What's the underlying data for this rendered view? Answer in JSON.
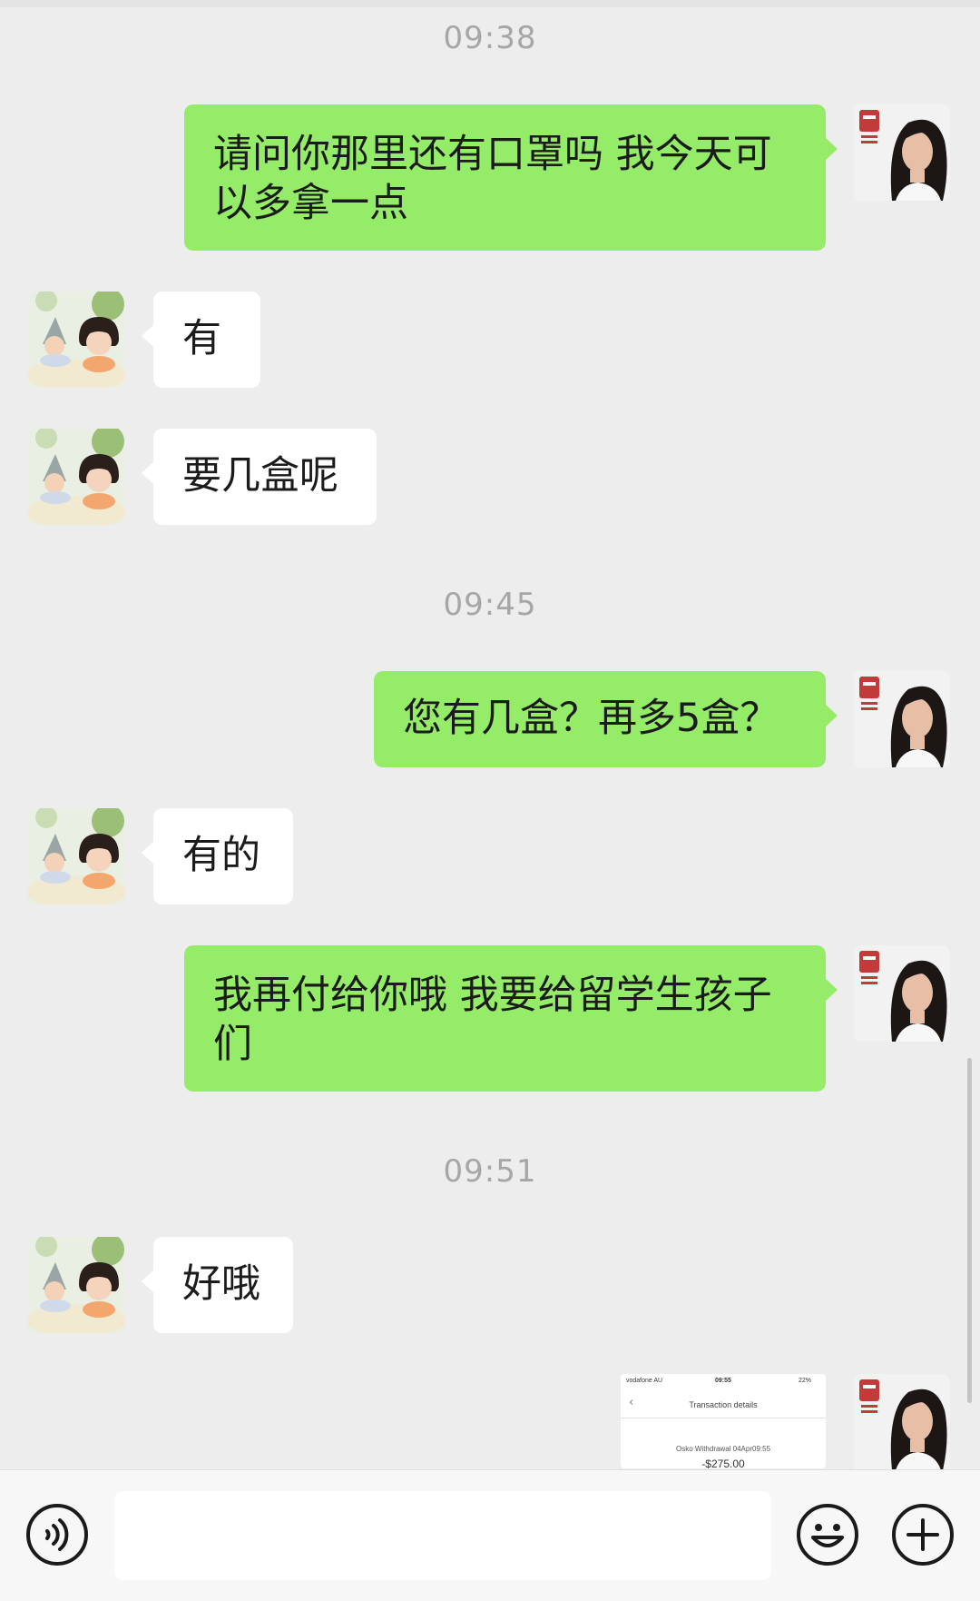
{
  "timestamps": [
    "09:38",
    "09:45",
    "09:51"
  ],
  "messages": [
    {
      "side": "right",
      "text": "请问你那里还有口罩吗 我今天可以多拿一点"
    },
    {
      "side": "left",
      "text": "有"
    },
    {
      "side": "left",
      "text": "要几盒呢"
    },
    {
      "side": "right",
      "text": "您有几盒？再多5盒？"
    },
    {
      "side": "left",
      "text": "有的"
    },
    {
      "side": "right",
      "text": "我再付给你哦 我要给留学生孩子们"
    },
    {
      "side": "left",
      "text": "好哦"
    }
  ],
  "image_message": {
    "side": "right",
    "carrier": "vodafone AU",
    "time": "09:55",
    "battery": "22%",
    "title": "Transaction details",
    "description": "Osko Withdrawal 04Apr09:55",
    "amount": "-$275.00"
  },
  "icons": {
    "voice": "voice-mode-icon",
    "emoji": "emoji-icon",
    "more": "plus-icon",
    "back": "chevron-left-icon"
  },
  "colors": {
    "background": "#ededed",
    "outgoing_bubble": "#95ec69",
    "incoming_bubble": "#ffffff",
    "timestamp": "#a6a6a6"
  }
}
